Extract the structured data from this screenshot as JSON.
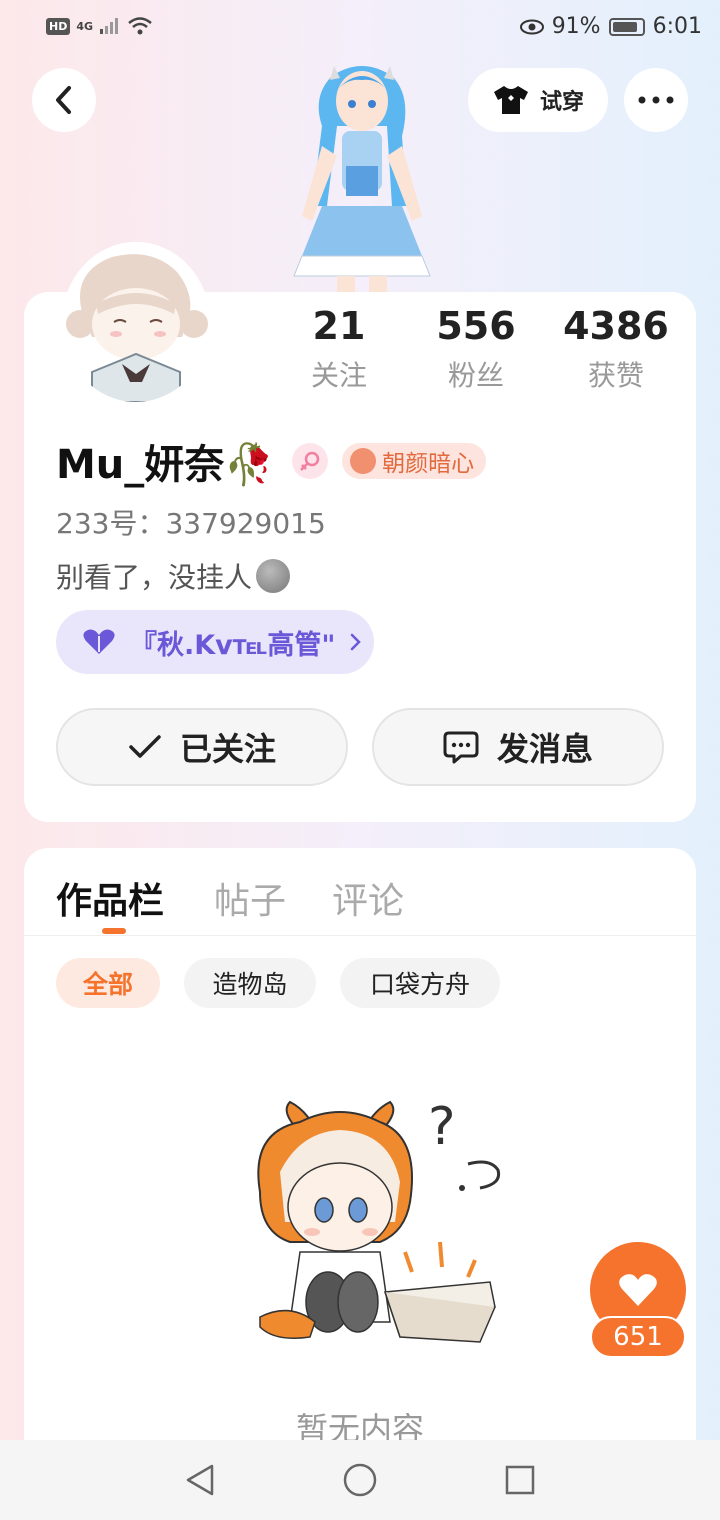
{
  "status_bar": {
    "hd": "HD",
    "network": "4G",
    "battery": "91%",
    "time": "6:01"
  },
  "header": {
    "tryon_label": "试穿"
  },
  "profile": {
    "stats": [
      {
        "value": "21",
        "label": "关注"
      },
      {
        "value": "556",
        "label": "粉丝"
      },
      {
        "value": "4386",
        "label": "获赞"
      }
    ],
    "username": "Mu_妍奈🥀",
    "title_badge": "朝颜暗心",
    "user_id": "233号：337929015",
    "bio": "别看了，没挂人",
    "group": "『秋.Kv℡高管\"",
    "follow_label": "已关注",
    "message_label": "发消息"
  },
  "works": {
    "tabs": [
      "作品栏",
      "帖子",
      "评论"
    ],
    "chips": [
      "全部",
      "造物岛",
      "口袋方舟"
    ],
    "empty_text": "暂无内容"
  },
  "like": {
    "count": "651"
  },
  "colors": {
    "accent": "#f5732d",
    "group_text": "#6a58d8",
    "badge_text": "#e36a3e"
  },
  "icons": [
    "back-icon",
    "shirt-icon",
    "more-icon",
    "female-icon",
    "heart-icon",
    "chevron-right-icon",
    "check-icon",
    "chat-icon",
    "like-heart-icon",
    "nav-back-icon",
    "nav-home-icon",
    "nav-recent-icon"
  ]
}
